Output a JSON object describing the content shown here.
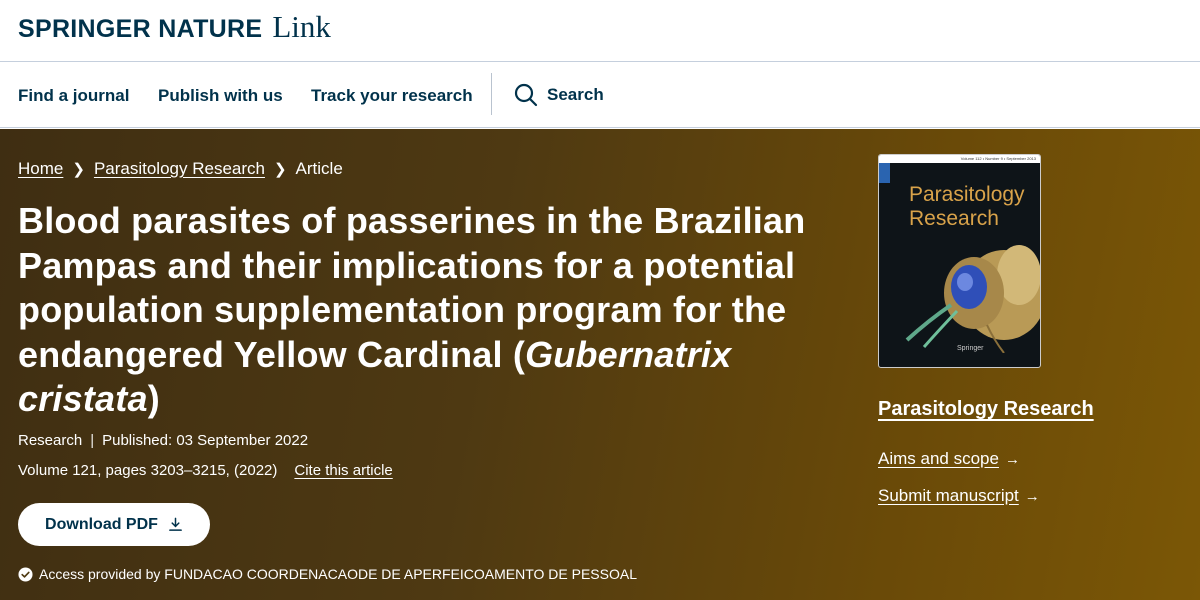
{
  "brand": {
    "name": "SPRINGER NATURE",
    "product": "Link"
  },
  "nav": {
    "find_journal": "Find a journal",
    "publish": "Publish with us",
    "track": "Track your research",
    "search": "Search"
  },
  "breadcrumb": {
    "home": "Home",
    "journal": "Parasitology Research",
    "current": "Article"
  },
  "article": {
    "title_main": "Blood parasites of passerines in the Brazilian Pampas and their implications for a potential population supplementation program for the endangered Yellow Cardinal (",
    "title_species": "Gubernatrix cristata",
    "title_close": ")",
    "type": "Research",
    "separator": "|",
    "published": "Published: 03 September 2022",
    "volume": "Volume 121, pages 3203–3215, (2022)",
    "cite": "Cite this article",
    "download": "Download PDF",
    "access": "Access provided by FUNDACAO COORDENACAODE DE APERFEICOAMENTO DE PESSOAL"
  },
  "sidebar": {
    "cover_title": "Parasitology Research",
    "cover_strip": "Volume 112 • Number 9 • September 2013",
    "cover_publisher": "Springer",
    "journal_name": "Parasitology Research",
    "aims": "Aims and scope",
    "submit": "Submit manuscript"
  },
  "colors": {
    "brand": "#01324b",
    "hero_start": "#3f2e12",
    "hero_end": "#7b5706",
    "cover_title": "#d9a34a"
  },
  "icons": {
    "search": "search-icon",
    "download": "download-icon",
    "check": "check-circle-icon",
    "chevron": "chevron-right-icon",
    "arrow": "arrow-right-icon"
  }
}
